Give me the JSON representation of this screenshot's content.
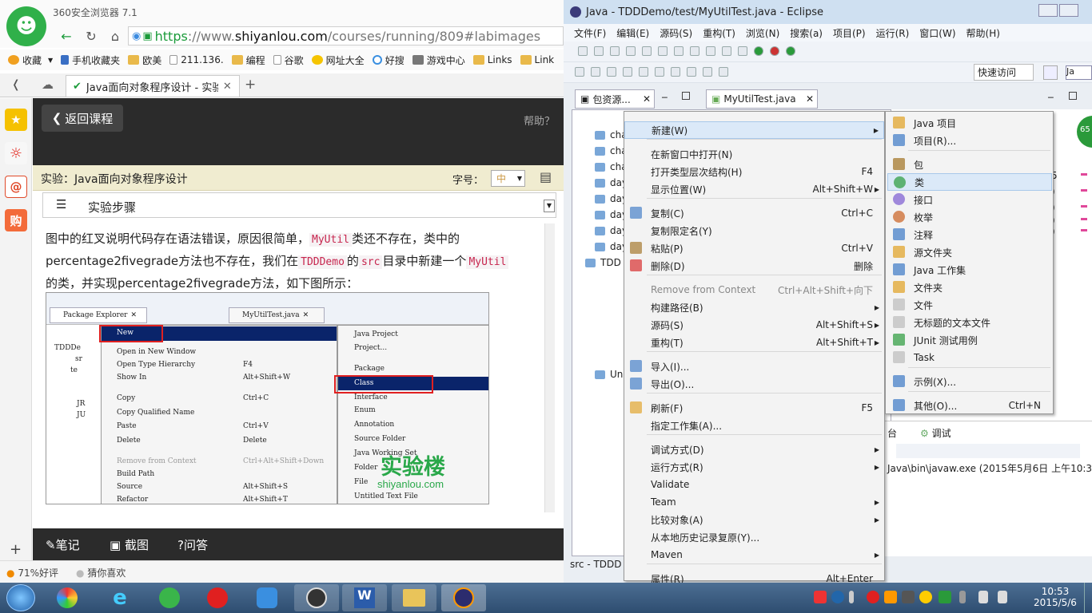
{
  "browser": {
    "title": "360安全浏览器 7.1",
    "url_https": "https",
    "url_sep": "://",
    "url_www": "www.",
    "url_domain": "shiyanlou.com",
    "url_path": "/courses/running/809#labimages",
    "bookmarks": [
      "收藏",
      "手机收藏夹",
      "欧美",
      "211.136.",
      "编程",
      "谷歌",
      "网址大全",
      "好搜",
      "游戏中心",
      "Links",
      "Link"
    ],
    "tab_title": "Java面向对象程序设计 - 实验楼"
  },
  "page": {
    "back_label": "返回课程",
    "help_label": "帮助？",
    "lab_title": "实验：Java面向对象程序设计",
    "font_label": "字号：",
    "font_value": "中",
    "steps_label": "实验步骤",
    "para_a": "图中的红叉说明代码存在语法错误，原因很简单，",
    "code_myutil": "MyUtil",
    "para_b": "类还不存在，类中的",
    "para_c": "percentage2fivegrade方法也不存在，我们在",
    "code_tdddemo": "TDDDemo",
    "para_d": "的",
    "code_src": "src",
    "para_e": "目录中新建一个",
    "para_f": "的类，并实现percentage2fivegrade方法，如下图所示：",
    "bottom_note": "笔记",
    "bottom_shot": "截图",
    "bottom_qa": "问答",
    "status_rating": "71%好评",
    "status_guess": "猜你喜欢"
  },
  "shot": {
    "tab_pkg": "Package Explorer",
    "tab_file": "MyUtilTest.java",
    "tree": [
      "TDDDe",
      "sr",
      "te",
      "JR",
      "JU"
    ],
    "menu": [
      {
        "label": "New",
        "sc": ""
      },
      {
        "label": "Open in New Window",
        "sc": ""
      },
      {
        "label": "Open Type Hierarchy",
        "sc": "F4"
      },
      {
        "label": "Show In",
        "sc": "Alt+Shift+W"
      },
      {
        "label": "Copy",
        "sc": "Ctrl+C"
      },
      {
        "label": "Copy Qualified Name",
        "sc": ""
      },
      {
        "label": "Paste",
        "sc": "Ctrl+V"
      },
      {
        "label": "Delete",
        "sc": "Delete"
      },
      {
        "label": "Remove from Context",
        "sc": "Ctrl+Alt+Shift+Down"
      },
      {
        "label": "Build Path",
        "sc": ""
      },
      {
        "label": "Source",
        "sc": "Alt+Shift+S"
      },
      {
        "label": "Refactor",
        "sc": "Alt+Shift+T"
      }
    ],
    "submenu": [
      "Java Project",
      "Project...",
      "Package",
      "Class",
      "Interface",
      "Enum",
      "Annotation",
      "Source Folder",
      "Java Working Set",
      "Folder",
      "File",
      "Untitled Text File"
    ],
    "watermark": "实验楼",
    "watermark_url": "shiyanlou.com"
  },
  "eclipse": {
    "title": "Java - TDDDemo/test/MyUtilTest.java - Eclipse",
    "menus": [
      "文件(F)",
      "编辑(E)",
      "源码(S)",
      "重构(T)",
      "浏览(N)",
      "搜索(a)",
      "项目(P)",
      "运行(R)",
      "窗口(W)",
      "帮助(H)"
    ],
    "quick_access": "快速访问",
    "view_pkg": "包资源...",
    "view_file": "MyUtilTest.java",
    "tree": [
      "cha",
      "cha",
      "cha",
      "day",
      "day",
      "day",
      "day",
      "day",
      "TDD",
      "Uni"
    ],
    "console_tabs": "台",
    "debug_tab": "调试",
    "console_text": "Java\\bin\\javaw.exe (2015年5月6日 上午10:3",
    "status": "src - TDDD",
    "badge": "65",
    "p_marks": [
      "5",
      ")",
      ")",
      ")",
      ")",
      ")"
    ]
  },
  "context_menu": [
    {
      "label": "新建(W)",
      "sc": "",
      "arrow": true
    },
    {
      "label": "在新窗口中打开(N)",
      "sc": ""
    },
    {
      "label": "打开类型层次结构(H)",
      "sc": "F4"
    },
    {
      "label": "显示位置(W)",
      "sc": "Alt+Shift+W",
      "arrow": true
    },
    {
      "label": "复制(C)",
      "sc": "Ctrl+C"
    },
    {
      "label": "复制限定名(Y)",
      "sc": ""
    },
    {
      "label": "粘贴(P)",
      "sc": "Ctrl+V"
    },
    {
      "label": "删除(D)",
      "sc": "删除"
    },
    {
      "label": "Remove from Context",
      "sc": "Ctrl+Alt+Shift+向下"
    },
    {
      "label": "构建路径(B)",
      "sc": "",
      "arrow": true
    },
    {
      "label": "源码(S)",
      "sc": "Alt+Shift+S",
      "arrow": true
    },
    {
      "label": "重构(T)",
      "sc": "Alt+Shift+T",
      "arrow": true
    },
    {
      "label": "导入(I)...",
      "sc": ""
    },
    {
      "label": "导出(O)...",
      "sc": ""
    },
    {
      "label": "刷新(F)",
      "sc": "F5"
    },
    {
      "label": "指定工作集(A)...",
      "sc": ""
    },
    {
      "label": "调试方式(D)",
      "sc": "",
      "arrow": true
    },
    {
      "label": "运行方式(R)",
      "sc": "",
      "arrow": true
    },
    {
      "label": "Validate",
      "sc": ""
    },
    {
      "label": "Team",
      "sc": "",
      "arrow": true
    },
    {
      "label": "比较对象(A)",
      "sc": "",
      "arrow": true
    },
    {
      "label": "从本地历史记录复原(Y)...",
      "sc": ""
    },
    {
      "label": "Maven",
      "sc": "",
      "arrow": true
    },
    {
      "label": "属性(R)",
      "sc": "Alt+Enter"
    }
  ],
  "submenu": [
    {
      "label": "Java 项目",
      "sc": ""
    },
    {
      "label": "项目(R)...",
      "sc": ""
    },
    {
      "label": "包",
      "sc": ""
    },
    {
      "label": "类",
      "sc": ""
    },
    {
      "label": "接口",
      "sc": ""
    },
    {
      "label": "枚举",
      "sc": ""
    },
    {
      "label": "注释",
      "sc": ""
    },
    {
      "label": "源文件夹",
      "sc": ""
    },
    {
      "label": "Java 工作集",
      "sc": ""
    },
    {
      "label": "文件夹",
      "sc": ""
    },
    {
      "label": "文件",
      "sc": ""
    },
    {
      "label": "无标题的文本文件",
      "sc": ""
    },
    {
      "label": "JUnit 测试用例",
      "sc": ""
    },
    {
      "label": "Task",
      "sc": ""
    },
    {
      "label": "示例(X)...",
      "sc": ""
    },
    {
      "label": "其他(O)...",
      "sc": "Ctrl+N"
    }
  ],
  "taskbar": {
    "time": "10:53",
    "date": "2015/5/6"
  },
  "colors": {
    "accent": "#3b78c4",
    "green": "#1b9b3a",
    "code": "#c7254e",
    "highlight": "#dbe9f8"
  }
}
